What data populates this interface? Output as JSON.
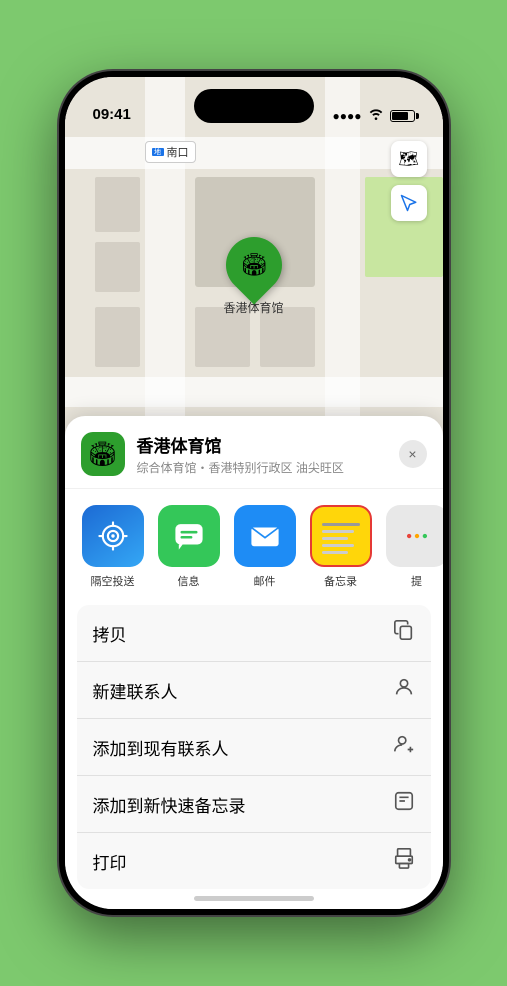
{
  "status_bar": {
    "time": "09:41",
    "location_arrow": "▲"
  },
  "map": {
    "venue_label": "南口",
    "pin_emoji": "🏟",
    "pin_label": "香港体育馆"
  },
  "sheet": {
    "venue_name": "香港体育馆",
    "venue_subtitle": "综合体育馆・香港特别行政区 油尖旺区",
    "close_label": "×"
  },
  "share_items": [
    {
      "id": "airdrop",
      "label": "隔空投送"
    },
    {
      "id": "messages",
      "label": "信息"
    },
    {
      "id": "mail",
      "label": "邮件"
    },
    {
      "id": "notes",
      "label": "备忘录"
    },
    {
      "id": "more",
      "label": "提"
    }
  ],
  "actions": [
    {
      "label": "拷贝",
      "icon": "📋"
    },
    {
      "label": "新建联系人",
      "icon": "👤"
    },
    {
      "label": "添加到现有联系人",
      "icon": "👤"
    },
    {
      "label": "添加到新快速备忘录",
      "icon": "📝"
    },
    {
      "label": "打印",
      "icon": "🖨"
    }
  ],
  "map_buttons": {
    "layers": "🗺",
    "location": "➤"
  }
}
